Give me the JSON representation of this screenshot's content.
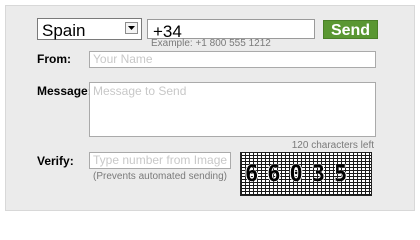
{
  "form": {
    "country": {
      "selected": "Spain"
    },
    "phone": {
      "value": "+34",
      "hint": "Example: +1 800 555 1212"
    },
    "send_label": "Send",
    "from": {
      "label": "From:",
      "placeholder": "Your Name"
    },
    "message": {
      "label": "Message:",
      "placeholder": "Message to Send",
      "char_count": "120 characters left"
    },
    "verify": {
      "label": "Verify:",
      "placeholder": "Type number from Image –",
      "hint": "(Prevents automated sending)",
      "captcha_text": "66035"
    }
  },
  "colors": {
    "send_button": "#5a9732",
    "panel_background": "#ebebeb",
    "placeholder_text": "#c8c8c8",
    "hint_text": "#7a7a7a"
  },
  "icons": {
    "dropdown": "chevron-down-icon"
  }
}
